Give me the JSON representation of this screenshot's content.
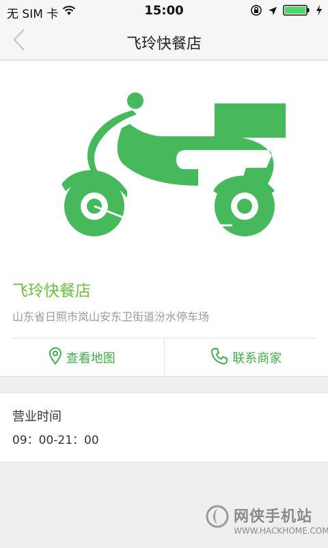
{
  "status_bar": {
    "carrier": "无 SIM 卡",
    "time": "15:00"
  },
  "nav": {
    "title": "飞玲快餐店"
  },
  "shop": {
    "name": "飞玲快餐店",
    "address": "山东省日照市岚山安东卫街道汾水停车场",
    "accent_color": "#6bbf3b"
  },
  "actions": {
    "map_label": "查看地图",
    "contact_label": "联系商家"
  },
  "hours": {
    "title": "营业时间",
    "value": "09：00-21：00"
  },
  "watermark": {
    "cn": "网侠手机站",
    "en": "WWW.HACKHOME.COM"
  },
  "icons": [
    "back-chevron-icon",
    "wifi-icon",
    "lock-rotation-icon",
    "location-arrow-icon",
    "battery-icon",
    "charging-bolt-icon",
    "map-pin-icon",
    "phone-icon",
    "scooter-illustration"
  ]
}
